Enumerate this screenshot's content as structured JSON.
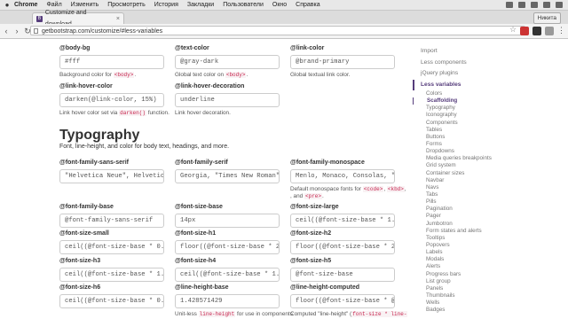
{
  "menubar": {
    "apple": "",
    "items": [
      "Chrome",
      "Файл",
      "Изменить",
      "Просмотреть",
      "История",
      "Закладки",
      "Пользователи",
      "Окно",
      "Справка"
    ]
  },
  "tab": {
    "title": "Customize and download",
    "favicon": "B"
  },
  "profile": "Никита",
  "address": {
    "url": "getbootstrap.com/customize/#less-variables"
  },
  "sections": {
    "typography_heading": "Typography",
    "typography_lead": "Font, line-height, and color for body text, headings, and more."
  },
  "fields": {
    "body_bg": {
      "label": "@body-bg",
      "value": "#fff",
      "help_pre": "Background color for ",
      "help_code": "<body>",
      "help_post": "."
    },
    "text_color": {
      "label": "@text-color",
      "value": "@gray-dark",
      "help_pre": "Global text color on ",
      "help_code": "<body>",
      "help_post": "."
    },
    "link_color": {
      "label": "@link-color",
      "value": "@brand-primary",
      "help": "Global textual link color."
    },
    "link_hover_color": {
      "label": "@link-hover-color",
      "value": "darken(@link-color, 15%)",
      "help_pre": "Link hover color set via ",
      "help_code": "darken()",
      "help_post": " function."
    },
    "link_hover_decoration": {
      "label": "@link-hover-decoration",
      "value": "underline",
      "help": "Link hover decoration."
    },
    "font_family_sans_serif": {
      "label": "@font-family-sans-serif",
      "value": "\"Helvetica Neue\", Helvetica,"
    },
    "font_family_serif": {
      "label": "@font-family-serif",
      "value": "Georgia, \"Times New Roman\","
    },
    "font_family_monospace": {
      "label": "@font-family-monospace",
      "value": "Menlo, Monaco, Consolas, \"Co",
      "help_pre": "Default monospace fonts for ",
      "help_code1": "<code>",
      "help_mid": ", ",
      "help_code2": "<kbd>",
      "help_mid2": ", and ",
      "help_code3": "<pre>",
      "help_post": "."
    },
    "font_family_base": {
      "label": "@font-family-base",
      "value": "@font-family-sans-serif"
    },
    "font_size_base": {
      "label": "@font-size-base",
      "value": "14px"
    },
    "font_size_large": {
      "label": "@font-size-large",
      "value": "ceil((@font-size-base * 1.25"
    },
    "font_size_small": {
      "label": "@font-size-small",
      "value": "ceil((@font-size-base * 0.85"
    },
    "font_size_h1": {
      "label": "@font-size-h1",
      "value": "floor((@font-size-base * 2.6"
    },
    "font_size_h2": {
      "label": "@font-size-h2",
      "value": "floor((@font-size-base * 2.1"
    },
    "font_size_h3": {
      "label": "@font-size-h3",
      "value": "ceil((@font-size-base * 1.7)"
    },
    "font_size_h4": {
      "label": "@font-size-h4",
      "value": "ceil((@font-size-base * 1.25"
    },
    "font_size_h5": {
      "label": "@font-size-h5",
      "value": "@font-size-base"
    },
    "font_size_h6": {
      "label": "@font-size-h6",
      "value": "ceil((@font-size-base * 0.85"
    },
    "line_height_base": {
      "label": "@line-height-base",
      "value": "1.428571429",
      "help_pre": "Unit-less ",
      "help_code": "line-height",
      "help_post": " for use in components"
    },
    "line_height_computed": {
      "label": "@line-height-computed",
      "value": "floor((@font-size-base * @li",
      "help_pre": "Computed \"line-height\" (",
      "help_code": "font-size * line-",
      "help_post": ""
    }
  },
  "sidenav": {
    "top_items": [
      "Import",
      "Less components",
      "jQuery plugins"
    ],
    "active": "Less variables",
    "sub_items": [
      "Colors",
      "Scaffolding",
      "Typography",
      "Iconography",
      "Components",
      "Tables",
      "Buttons",
      "Forms",
      "Dropdowns",
      "Media queries breakpoints",
      "Grid system",
      "Container sizes",
      "Navbar",
      "Navs",
      "Tabs",
      "Pills",
      "Pagination",
      "Pager",
      "Jumbotron",
      "Form states and alerts",
      "Tooltips",
      "Popovers",
      "Labels",
      "Modals",
      "Alerts",
      "Progress bars",
      "List group",
      "Panels",
      "Thumbnails",
      "Wells",
      "Badges"
    ],
    "sub_active": "Scaffolding"
  },
  "colors": {
    "brand": "#563d7c",
    "code": "#c7254e"
  }
}
